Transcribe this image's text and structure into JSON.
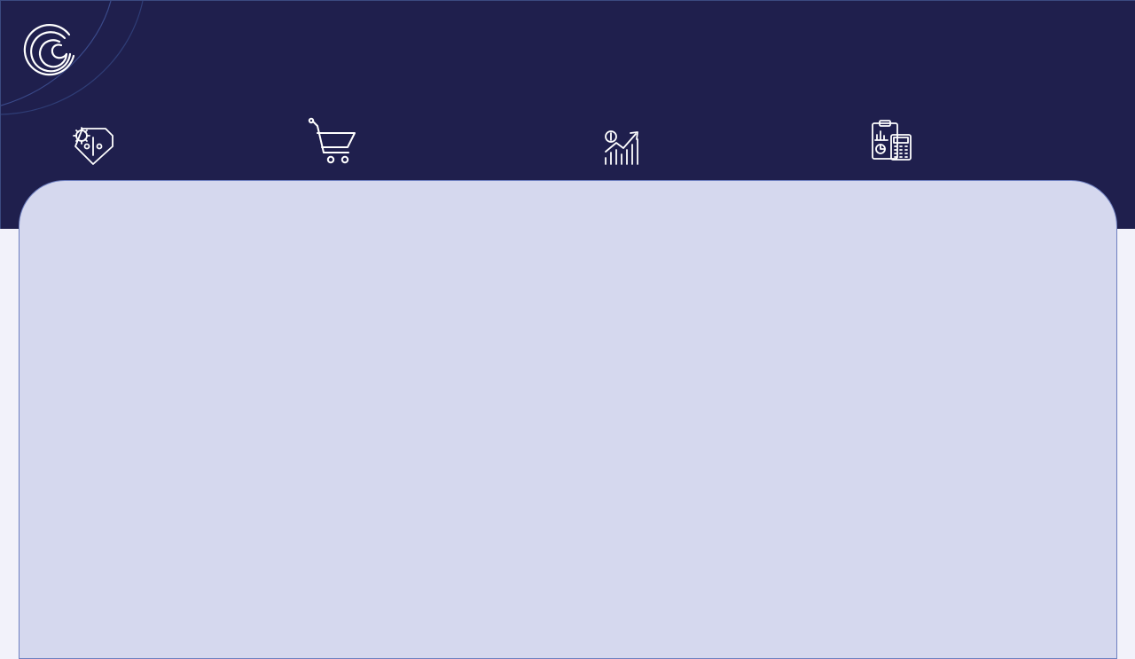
{
  "brand": {
    "logo_icon": "crescent-swirl-logo-icon"
  },
  "nav": {
    "items": [
      {
        "id": "pricing",
        "icon": "price-tag-percent-gear-icon"
      },
      {
        "id": "cart",
        "icon": "shopping-cart-icon"
      },
      {
        "id": "growth",
        "icon": "money-growth-chart-icon"
      },
      {
        "id": "reports",
        "icon": "clipboard-calculator-icon"
      }
    ]
  },
  "colors": {
    "header_bg": "#1f1f4d",
    "panel_bg": "#d5d8ee",
    "panel_border": "#6f80c0",
    "page_bg": "#f2f2fa",
    "icon_stroke": "#ffffff"
  },
  "main": {
    "content": ""
  }
}
